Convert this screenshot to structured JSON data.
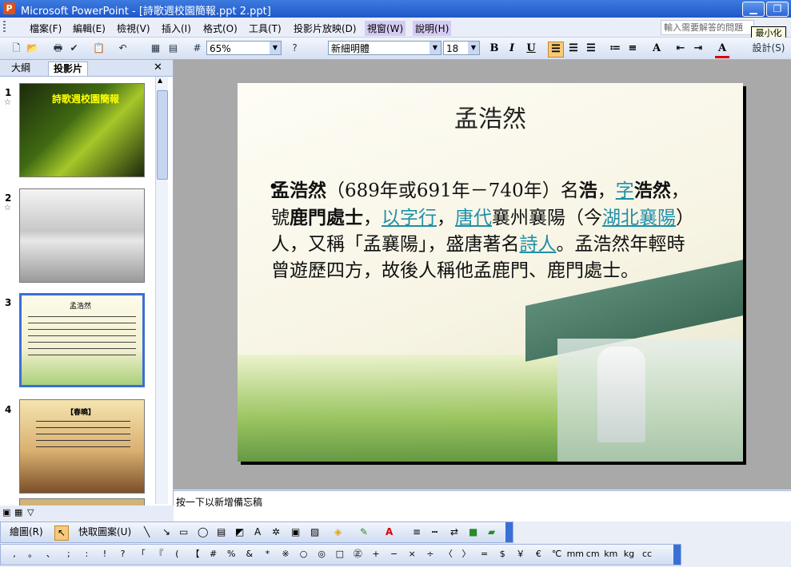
{
  "window": {
    "title": "Microsoft PowerPoint - [詩歌週校園簡報.ppt 2.ppt]",
    "minimize_tooltip": "最小化"
  },
  "menu": {
    "items": [
      "檔案(F)",
      "編輯(E)",
      "檢視(V)",
      "插入(I)",
      "格式(O)",
      "工具(T)",
      "投影片放映(D)",
      "視窗(W)",
      "說明(H)"
    ],
    "ask_placeholder": "輸入需要解答的問題"
  },
  "toolbar": {
    "zoom": "65%",
    "font": "新細明體",
    "font_size": "18",
    "design_label": "設計(S)"
  },
  "pane": {
    "tab_outline": "大綱",
    "tab_slides": "投影片",
    "slide_numbers": [
      "1",
      "2",
      "3",
      "4"
    ],
    "thumb1_title": "詩歌週校園簡報",
    "thumb3_title": "孟浩然",
    "thumb4_title": "【春曉】"
  },
  "slide": {
    "title": "孟浩然",
    "body": {
      "p1": "孟浩然",
      "p2": "（689年或691年－740年）名",
      "p3": "浩",
      "p4": "，",
      "link_zi": "字",
      "p5": "浩然",
      "p6": "，號",
      "p7": "鹿門處士",
      "p8": "，",
      "link_yizixing": "以字行",
      "p9": "，",
      "link_tangdai": "唐代",
      "p10": "襄州襄陽（今",
      "link_hubei": "湖北襄陽",
      "p11": "）人，又稱「孟襄陽」，盛唐著名",
      "link_shiren": "詩人",
      "p12": "。孟浩然年輕時曾遊歷四方，故後人稱他孟鹿門、鹿門處士。"
    }
  },
  "notes": {
    "placeholder": "按一下以新增備忘稿"
  },
  "drawing": {
    "draw_label": "繪圖(R)",
    "autoshape_label": "快取圖案(U)"
  },
  "symbols": [
    ",",
    "。",
    "、",
    ";",
    ":",
    "!",
    "?",
    "「",
    "『",
    "(",
    "【",
    "#",
    "%",
    "&",
    "*",
    "※",
    "○",
    "◎",
    "□",
    "㊣",
    "+",
    "−",
    "×",
    "÷",
    "〈",
    "〉",
    "=",
    "$",
    "￥",
    "€",
    "℃",
    "mm",
    "cm",
    "km",
    "kg",
    "cc"
  ],
  "colors": {
    "titlebar": "#1f57c9",
    "link": "#1f8fa8",
    "canvas": "#a9a9a9"
  }
}
